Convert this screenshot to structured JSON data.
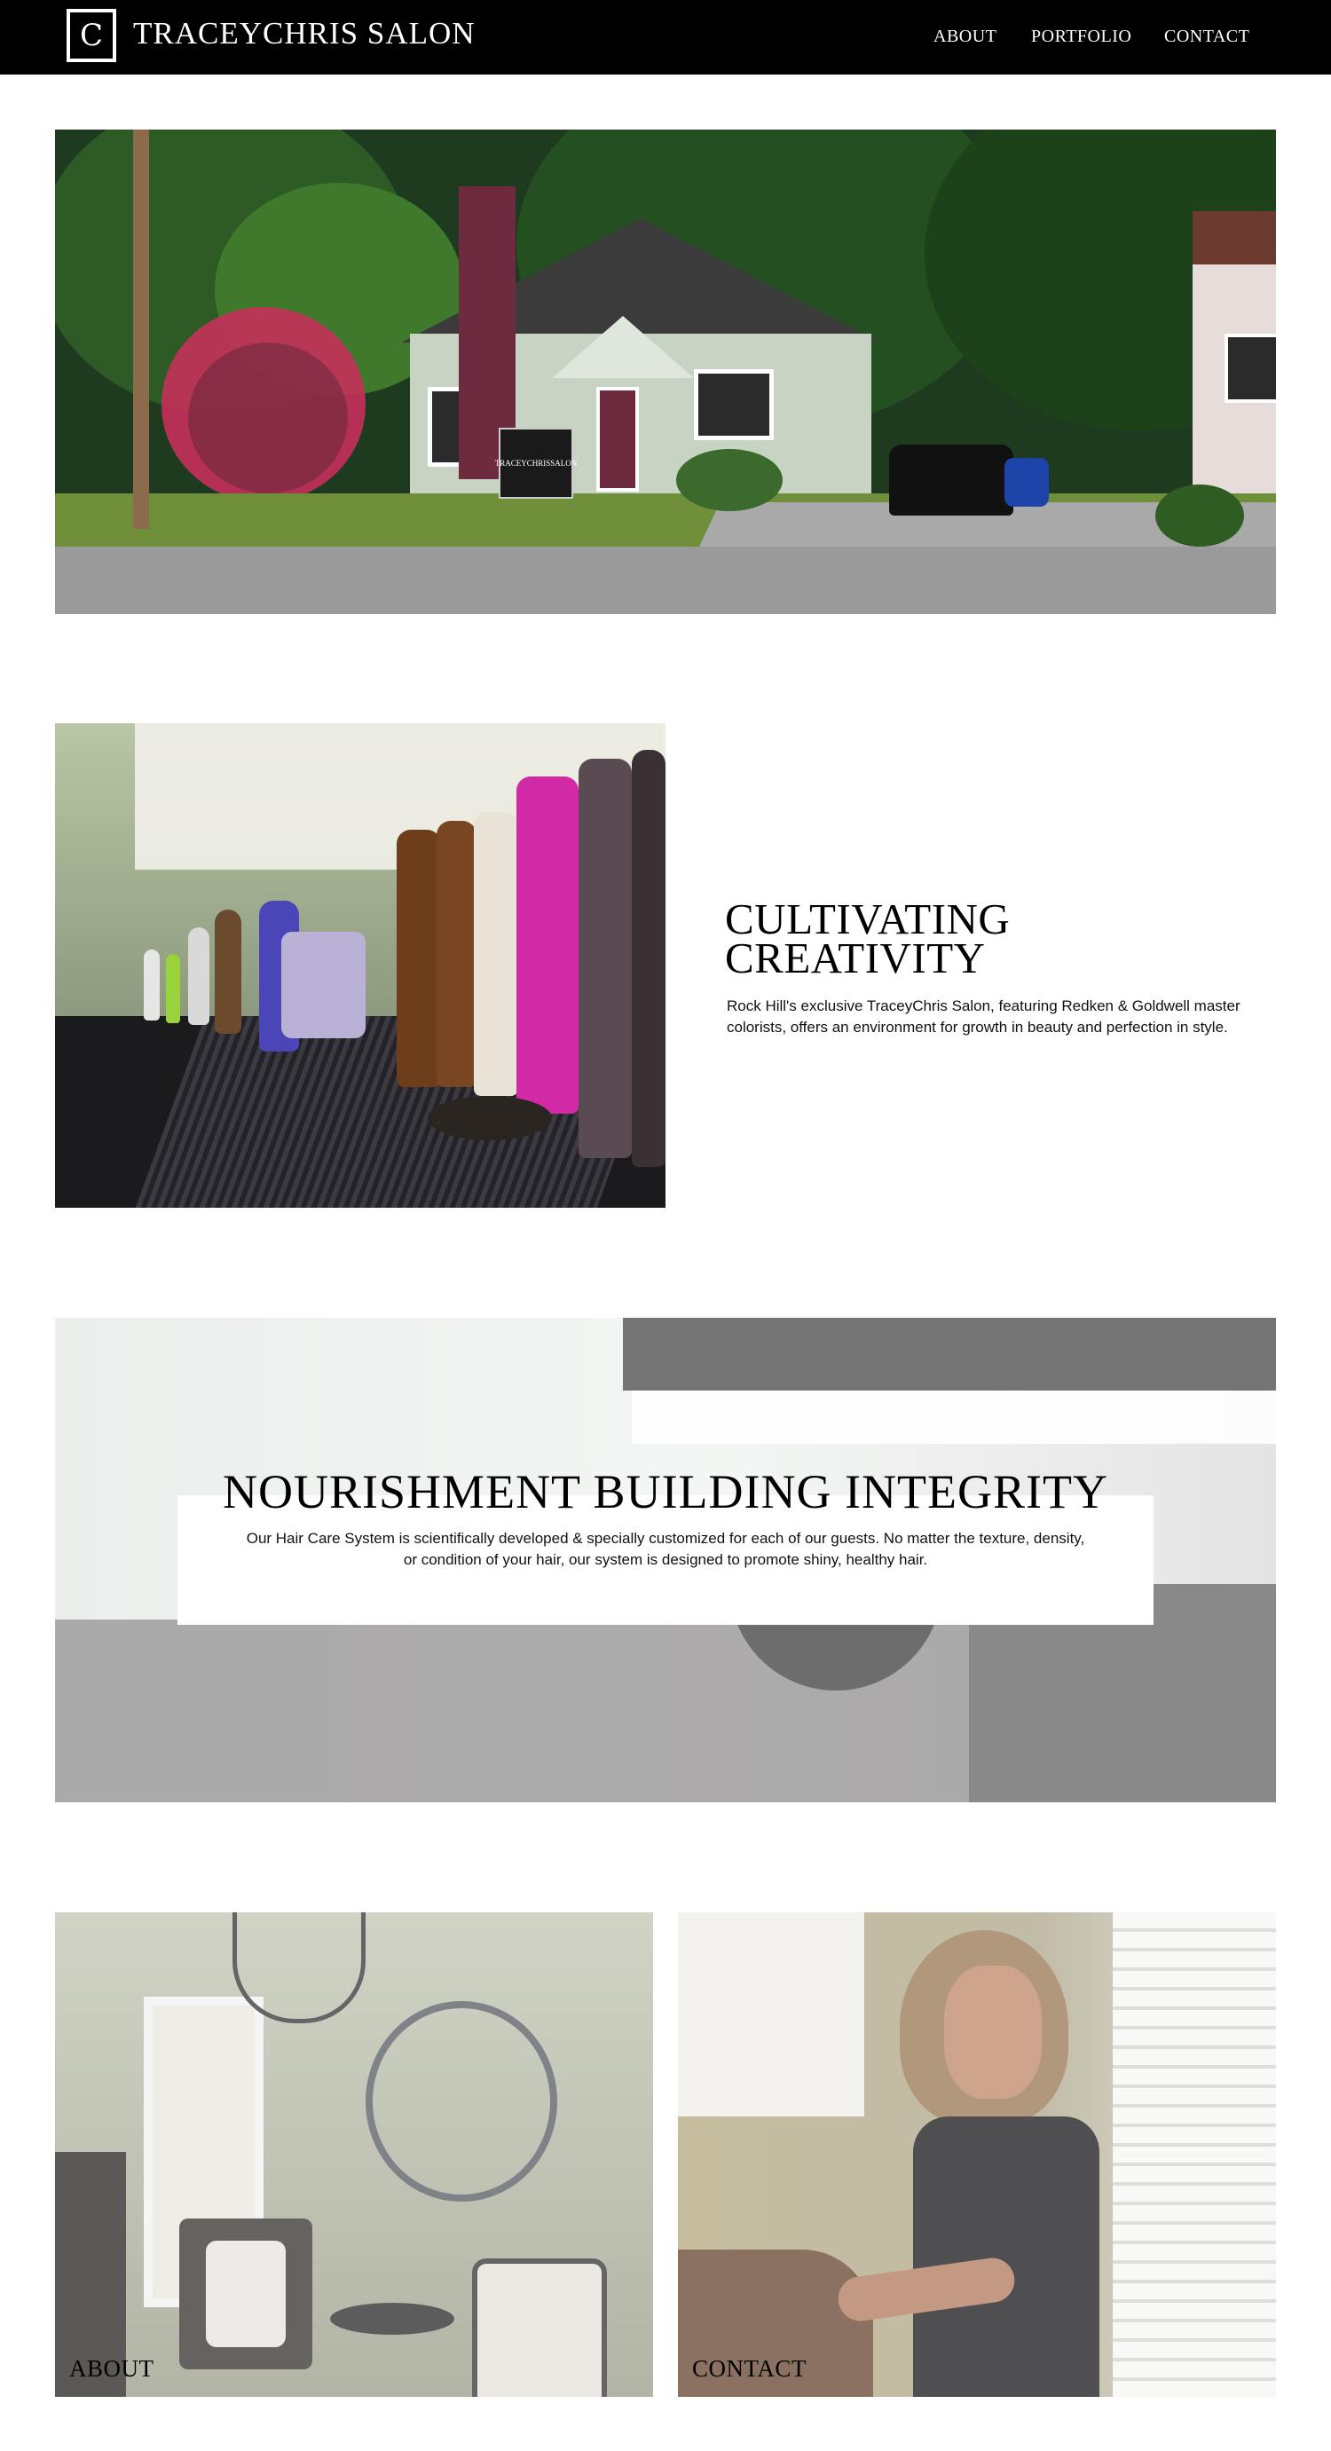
{
  "header": {
    "logo_glyph": "C",
    "brand": "TRACEYCHRIS SALON",
    "nav": [
      {
        "label": "ABOUT"
      },
      {
        "label": "PORTFOLIO"
      },
      {
        "label": "CONTACT"
      }
    ]
  },
  "hero": {
    "sign_lines": [
      "TRACEY",
      "CHRIS",
      "SALON"
    ]
  },
  "cultivating": {
    "title_line1": "CULTIVATING",
    "title_line2": "CREATIVITY",
    "body": "Rock Hill's exclusive TraceyChris Salon, featuring Redken & Goldwell master colorists, offers an environment for growth in beauty and perfection in style."
  },
  "nourishment": {
    "title": "NOURISHMENT BUILDING INTEGRITY",
    "body": "Our Hair Care System is scientifically developed & specially customized for each of our guests. No matter the texture, density, or condition of your hair, our system is designed to promote shiny, healthy hair."
  },
  "cards": [
    {
      "label": "ABOUT"
    },
    {
      "label": "CONTACT"
    }
  ],
  "colors": {
    "header_bg": "#000000",
    "page_bg": "#ffffff",
    "text": "#000000"
  }
}
